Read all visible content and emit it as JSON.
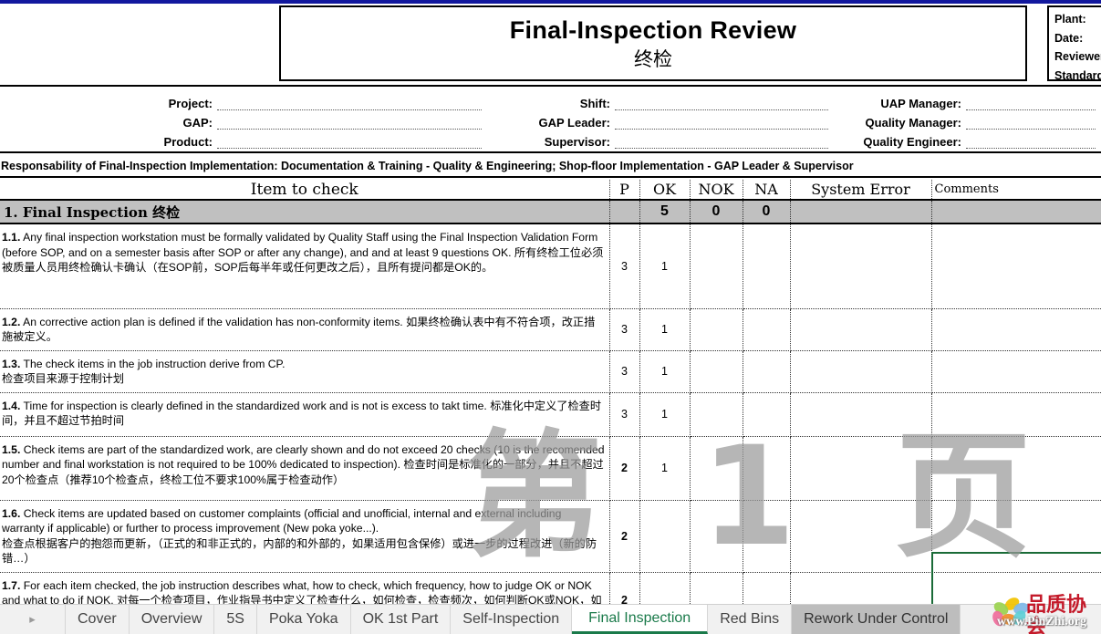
{
  "header": {
    "title_en": "Final-Inspection Review",
    "title_cn": "终检",
    "plant_block": {
      "plant_label": "Plant:",
      "date_label": "Date:",
      "reviewer_label": "Reviewer",
      "standard_label": "Standard"
    }
  },
  "info": {
    "col1": [
      {
        "label": "Project:",
        "value": ""
      },
      {
        "label": "GAP:",
        "value": ""
      },
      {
        "label": "Product:",
        "value": ""
      }
    ],
    "col2": [
      {
        "label": "Shift:",
        "value": ""
      },
      {
        "label": "GAP Leader:",
        "value": ""
      },
      {
        "label": "Supervisor:",
        "value": ""
      }
    ],
    "col3": [
      {
        "label": "UAP Manager:",
        "value": ""
      },
      {
        "label": "Quality Manager:",
        "value": ""
      },
      {
        "label": "Quality Engineer:",
        "value": ""
      }
    ]
  },
  "responsibility": "Responsability of Final-Inspection Implementation: Documentation & Training - Quality & Engineering; Shop-floor Implementation - GAP Leader & Supervisor",
  "table": {
    "headers": {
      "item": "Item to check",
      "p": "P",
      "ok": "OK",
      "nok": "NOK",
      "na": "NA",
      "system_error": "System Error",
      "comments": "Comments"
    },
    "section": {
      "title": "1. Final Inspection 终检",
      "p": "",
      "ok": "5",
      "nok": "0",
      "na": "0",
      "system_error": "",
      "comments": ""
    },
    "rows": [
      {
        "num": "1.1.",
        "text_en": "Any final inspection workstation must be formally validated by Quality Staff using the Final Inspection Validation Form (before SOP, and on a semester basis after SOP or after any change), and and at least 9 questions OK.",
        "text_cn": "所有终检工位必须被质量人员用终检确认卡确认（在SOP前，SOP后每半年或任何更改之后），且所有提问都是OK的。",
        "p": "3",
        "ok": "1",
        "nok": "",
        "na": "",
        "system_error": "",
        "comments": ""
      },
      {
        "num": "1.2.",
        "text_en": "An corrective action plan is defined if the validation has non-conformity items.",
        "text_cn": "如果终检确认表中有不符合项，改正措施被定义。",
        "p": "3",
        "ok": "1",
        "nok": "",
        "na": "",
        "system_error": "",
        "comments": ""
      },
      {
        "num": "1.3.",
        "text_en": "The check items in the job instruction derive from CP.",
        "text_cn": "检查项目来源于控制计划",
        "p": "3",
        "ok": "1",
        "nok": "",
        "na": "",
        "system_error": "",
        "comments": ""
      },
      {
        "num": "1.4.",
        "text_en": "Time for inspection is clearly defined in the standardized work and is not is excess to takt time.",
        "text_cn": "标准化中定义了检查时间，并且不超过节拍时间",
        "p": "3",
        "ok": "1",
        "nok": "",
        "na": "",
        "system_error": "",
        "comments": ""
      },
      {
        "num": "1.5.",
        "text_en": "Check items are part of the standardized work, are clearly shown and do not exceed 20 checks (10 is the recomended number and final workstation is not required to be 100% dedicated to inspection).",
        "text_cn": "检查时间是标准化的一部分，并且不超过20个检查点（推荐10个检查点，终检工位不要求100%属于检查动作）",
        "p": "2",
        "ok": "1",
        "nok": "",
        "na": "",
        "system_error": "",
        "comments": ""
      },
      {
        "num": "1.6.",
        "text_en": "Check items are updated based on customer complaints (official and unofficial, internal and external including warranty if applicable) or further to process improvement (New poka yoke...).",
        "text_cn": "检查点根据客户的抱怨而更新，（正式的和非正式的，内部的和外部的，如果适用包含保修）或进一步的过程改进（新的防错…）",
        "p": "2",
        "ok": "",
        "nok": "",
        "na": "",
        "system_error": "",
        "comments": ""
      },
      {
        "num": "1.7.",
        "text_en": "For each item checked, the job instruction describes what, how to check, which frequency, how to judge OK or NOK and what to do if NOK.",
        "text_cn": "对每一个检查项目，作业指导书中定义了检查什么，如何检查，检查频次，如何判断OK或NOK，如果NOK，怎么做。",
        "p": "2",
        "ok": "",
        "nok": "",
        "na": "",
        "system_error": "",
        "comments": ""
      }
    ]
  },
  "watermark": "第 1 页",
  "tabs": {
    "nav_arrow": "▸",
    "items": [
      {
        "label": "Cover",
        "state": "normal"
      },
      {
        "label": "Overview",
        "state": "normal"
      },
      {
        "label": "5S",
        "state": "normal"
      },
      {
        "label": "Poka Yoka",
        "state": "normal"
      },
      {
        "label": "OK 1st Part",
        "state": "normal"
      },
      {
        "label": "Self-Inspection",
        "state": "normal"
      },
      {
        "label": "Final Inspection",
        "state": "active"
      },
      {
        "label": "Red Bins",
        "state": "normal"
      },
      {
        "label": "Rework Under Control",
        "state": "selected-dim"
      }
    ]
  },
  "logo": {
    "text_cn": "品质协会",
    "url": "www.PinZhi.org"
  },
  "colors": {
    "top_rule": "#12189e",
    "section_fill": "#c0c0c0",
    "active_tab": "#1a7a4a",
    "selection_border": "#1a6b37",
    "logo_red": "#c41a2a"
  }
}
